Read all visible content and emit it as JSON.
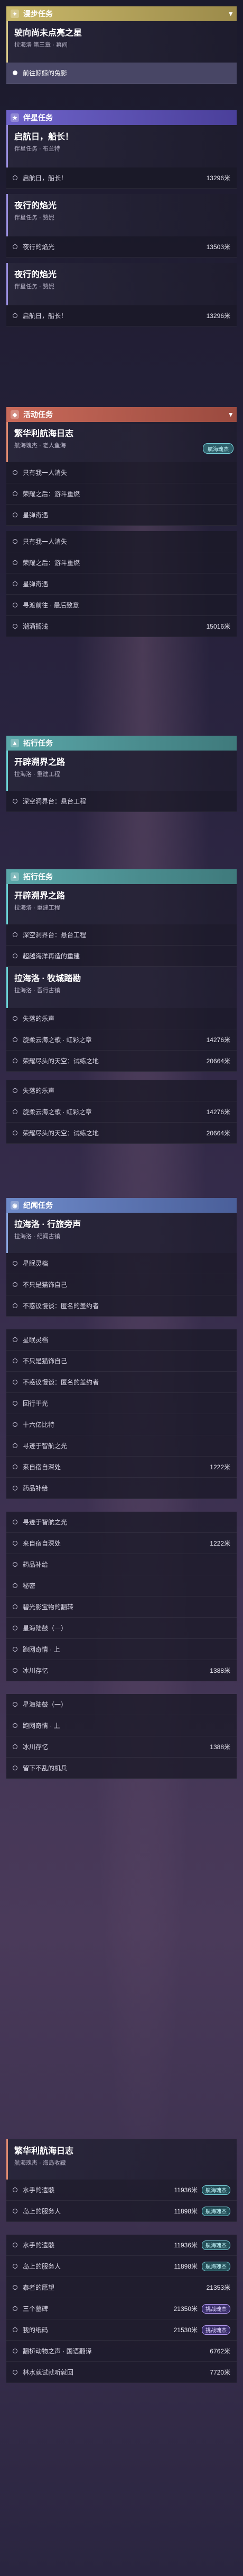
{
  "labels": {
    "nav_badge": "航海瑰杰",
    "challenge_badge": "挑战瑰杰"
  },
  "daily": {
    "header": "漫步任务",
    "card_title": "驶向尚未点亮之星",
    "card_sub": "拉海洛 第三章 · 幕间",
    "steps": [
      "前往鲸鲸的兔影"
    ]
  },
  "companion": {
    "header": "伴星任务",
    "card1_title": "启航日，船长！",
    "card1_sub": "伴星任务 · 布兰特",
    "card1_steps": [
      {
        "label": "启航日，船长！",
        "dist": "13296米"
      }
    ],
    "card2_title": "夜行的焰光",
    "card2_sub": "伴星任务 · 赞妮",
    "card2_steps": [
      {
        "label": "夜行的焰光",
        "dist": "13503米"
      }
    ],
    "card3_title": "夜行的焰光",
    "card3_sub": "伴星任务 · 赞妮",
    "card3_steps": [
      {
        "label": "启航日，船长！",
        "dist": "13296米"
      }
    ]
  },
  "event": {
    "header": "活动任务",
    "card_title": "繁华利航海日志",
    "card_sub": "航海瑰杰 · 老人鱼海",
    "steps": [
      {
        "label": "只有我一人消失",
        "dist": ""
      },
      {
        "label": "荣耀之后：游斗重燃",
        "dist": ""
      },
      {
        "label": "星弹奇遇",
        "dist": ""
      },
      {
        "label": "只有我一人消失",
        "dist": ""
      },
      {
        "label": "荣耀之后：游斗重燃",
        "dist": ""
      },
      {
        "label": "星弹奇遇",
        "dist": ""
      },
      {
        "label": "寻渡前往 · 最后致意",
        "dist": ""
      },
      {
        "label": "潮涌搁浅",
        "dist": "15016米"
      }
    ]
  },
  "trailblaze1": {
    "header": "拓行任务",
    "card_title": "开辟溯界之路",
    "card_sub": "拉海洛 · 重建工程",
    "steps": [
      "深空洞界台：悬台工程"
    ]
  },
  "trailblaze2": {
    "header": "拓行任务",
    "card1_title": "开辟溯界之路",
    "card1_sub": "拉海洛 · 重建工程",
    "card1_steps": [
      "深空洞界台：悬台工程",
      "超越海洋再造的重建"
    ],
    "card2_title": "拉海洛 · 牧城踏勘",
    "card2_sub": "拉海洛 · 吾行古镇",
    "card2_steps": [
      {
        "label": "失落的乐声",
        "dist": ""
      },
      {
        "label": "旋柔云海之歌 · 虹彩之章",
        "dist": "14276米"
      },
      {
        "label": "荣耀尽头的天空：试练之地",
        "dist": "20664米"
      },
      {
        "label": "失落的乐声",
        "dist": ""
      },
      {
        "label": "旋柔云海之歌 · 虹彩之章",
        "dist": "14276米"
      },
      {
        "label": "荣耀尽头的天空：试练之地",
        "dist": "20664米"
      }
    ]
  },
  "memory": {
    "header": "纪闻任务",
    "card_title": "拉海洛 · 行旅旁声",
    "card_sub": "拉海洛 · 纪闻古镇",
    "steps": [
      {
        "label": "星眠灵档",
        "dist": ""
      },
      {
        "label": "不只是猫饰自己",
        "dist": ""
      },
      {
        "label": "不惑议慢谈：匿名的盖约者",
        "dist": ""
      },
      {
        "label": "星眠灵档",
        "dist": ""
      },
      {
        "label": "不只是猫饰自己",
        "dist": ""
      },
      {
        "label": "不惑议慢谈：匿名的盖约者",
        "dist": ""
      },
      {
        "label": "回行于光",
        "dist": ""
      },
      {
        "label": "十六亿比特",
        "dist": ""
      },
      {
        "label": "寻迹于智航之光",
        "dist": ""
      },
      {
        "label": "来自宿自深处",
        "dist": "1222米"
      },
      {
        "label": "药品补给",
        "dist": ""
      },
      {
        "label": "寻迹于智航之光",
        "dist": ""
      },
      {
        "label": "来自宿自深处",
        "dist": "1222米"
      },
      {
        "label": "药品补给",
        "dist": ""
      },
      {
        "label": "秘密",
        "dist": ""
      },
      {
        "label": "碧光影宝物的翻转",
        "dist": ""
      },
      {
        "label": "星海陆鼓（一）",
        "dist": ""
      },
      {
        "label": "跑网奇情 · 上",
        "dist": ""
      },
      {
        "label": "冰川存忆",
        "dist": "1388米"
      },
      {
        "label": "星海陆鼓（一）",
        "dist": ""
      },
      {
        "label": "跑网奇情 · 上",
        "dist": ""
      },
      {
        "label": "冰川存忆",
        "dist": "1388米"
      },
      {
        "label": "留下不乱的机兵",
        "dist": ""
      }
    ]
  },
  "event2": {
    "card_title": "繁华利航海日志",
    "card_sub": "航海瑰杰 · 海岛收藏",
    "steps": [
      {
        "label": "水手的遗骸",
        "dist": "11936米",
        "badge": "nav"
      },
      {
        "label": "岛上的服务人",
        "dist": "11898米",
        "badge": "nav"
      },
      {
        "label": "水手的遗骸",
        "dist": "11936米",
        "badge": "nav"
      },
      {
        "label": "岛上的服务人",
        "dist": "11898米",
        "badge": "nav"
      },
      {
        "label": "泰者的愿望",
        "dist": "21353米",
        "badge": ""
      },
      {
        "label": "三个墓碑",
        "dist": "21350米",
        "badge": "challenge"
      },
      {
        "label": "我的纸码",
        "dist": "21530米",
        "badge": "challenge"
      },
      {
        "label": "翻桥动物之声 · 国语翻译",
        "dist": "6762米",
        "badge": ""
      },
      {
        "label": "林水就试就听就回",
        "dist": "7720米",
        "badge": ""
      }
    ]
  }
}
